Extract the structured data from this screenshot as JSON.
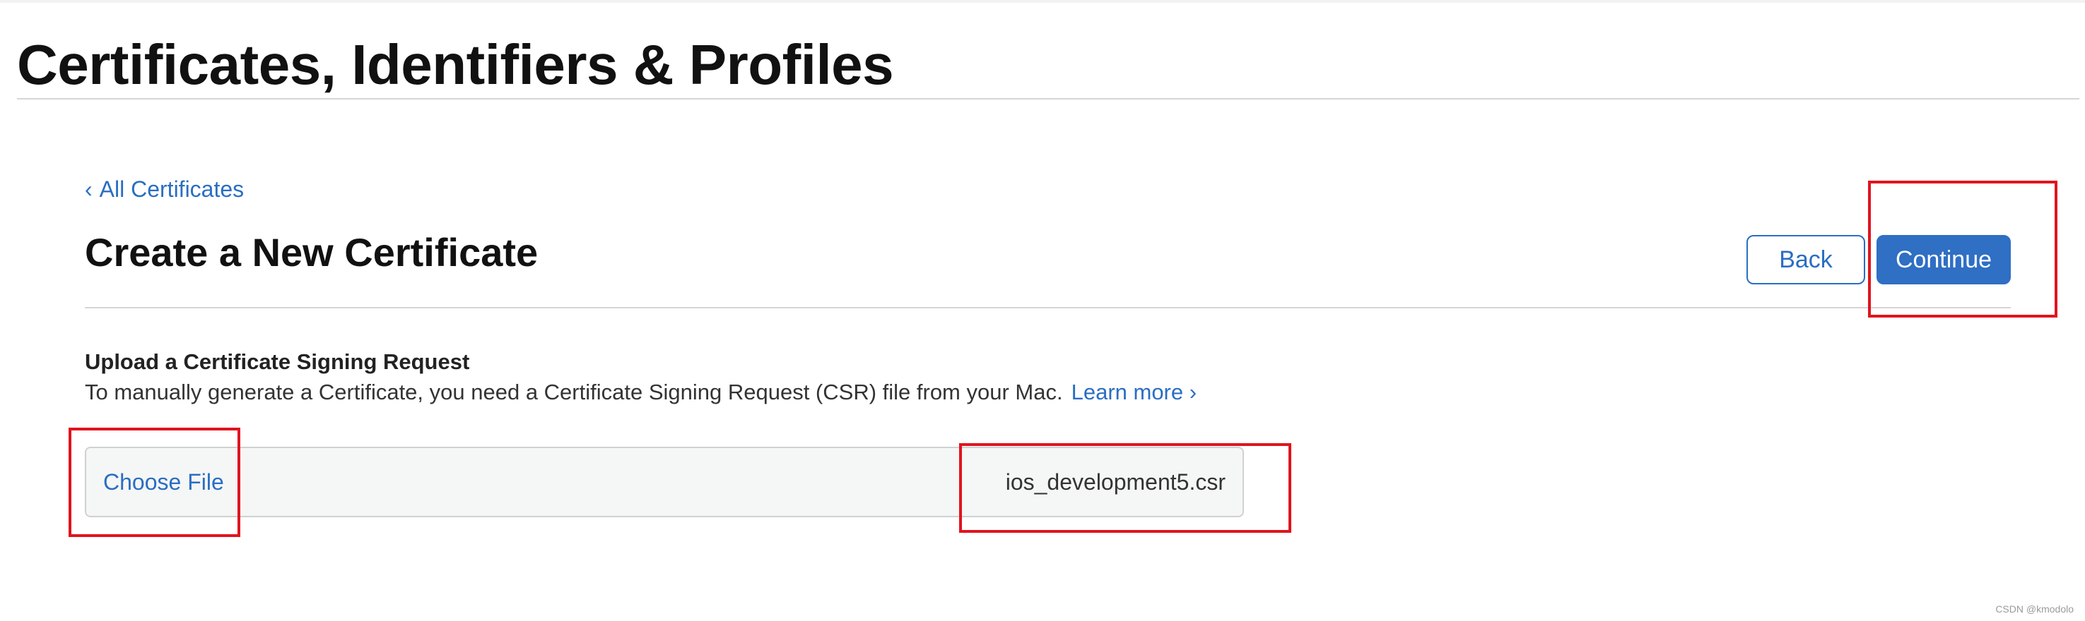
{
  "header": {
    "title": "Certificates, Identifiers & Profiles"
  },
  "breadcrumb": {
    "chevron": "‹",
    "label": "All Certificates"
  },
  "section": {
    "title": "Create a New Certificate",
    "back_label": "Back",
    "continue_label": "Continue"
  },
  "upload": {
    "heading": "Upload a Certificate Signing Request",
    "description": "To manually generate a Certificate, you need a Certificate Signing Request (CSR) file from your Mac.",
    "learn_more_label": "Learn more ›",
    "choose_file_label": "Choose File",
    "file_name": "ios_development5.csr"
  },
  "watermark": "CSDN @kmodolo",
  "colors": {
    "accent": "#2a6ec2",
    "primary_button": "#2f6fc4",
    "highlight": "#e0141e"
  }
}
